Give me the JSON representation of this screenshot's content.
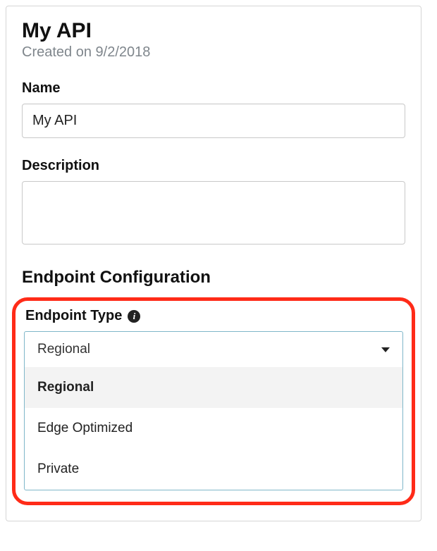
{
  "header": {
    "title": "My API",
    "created_text": "Created on 9/2/2018"
  },
  "fields": {
    "name": {
      "label": "Name",
      "value": "My API"
    },
    "description": {
      "label": "Description",
      "value": ""
    }
  },
  "endpoint_config": {
    "section_title": "Endpoint Configuration",
    "type_label": "Endpoint Type",
    "selected": "Regional",
    "options": [
      "Regional",
      "Edge Optimized",
      "Private"
    ]
  }
}
